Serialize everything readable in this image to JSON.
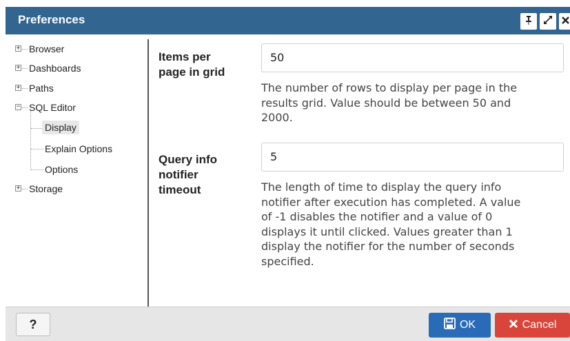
{
  "dialog": {
    "title": "Preferences",
    "title_bar_buttons": [
      "pin-icon",
      "maximize-icon",
      "close-icon"
    ]
  },
  "tree": {
    "nodes": [
      {
        "label": "Browser",
        "expanded": false
      },
      {
        "label": "Dashboards",
        "expanded": false
      },
      {
        "label": "Paths",
        "expanded": false
      },
      {
        "label": "SQL Editor",
        "expanded": true,
        "children": [
          {
            "label": "Display",
            "selected": true
          },
          {
            "label": "Explain Options"
          },
          {
            "label": "Options"
          }
        ]
      },
      {
        "label": "Storage",
        "expanded": false
      }
    ]
  },
  "settings": {
    "items_per_page": {
      "label_line1": "Items per",
      "label_line2": "page in grid",
      "value": "50",
      "help_lines": [
        "The number of rows to display per page in the",
        "results grid. Value should be between 50 and",
        "2000."
      ]
    },
    "query_info_timeout": {
      "label_line1": "Query info",
      "label_line2": "notifier",
      "label_line3": "timeout",
      "value": "5",
      "help_lines": [
        "The length of time to display the query info",
        "notifier after execution has completed. A value",
        "of -1 disables the notifier and a value of 0",
        "displays it until clicked. Values greater than 1",
        "display the notifier for the number of seconds",
        "specified."
      ]
    }
  },
  "footer": {
    "help_label": "?",
    "ok_label": "OK",
    "cancel_label": "Cancel"
  },
  "colors": {
    "title_bar": "#326690",
    "ok_button": "#2a6bb8",
    "cancel_button": "#d9453b"
  }
}
